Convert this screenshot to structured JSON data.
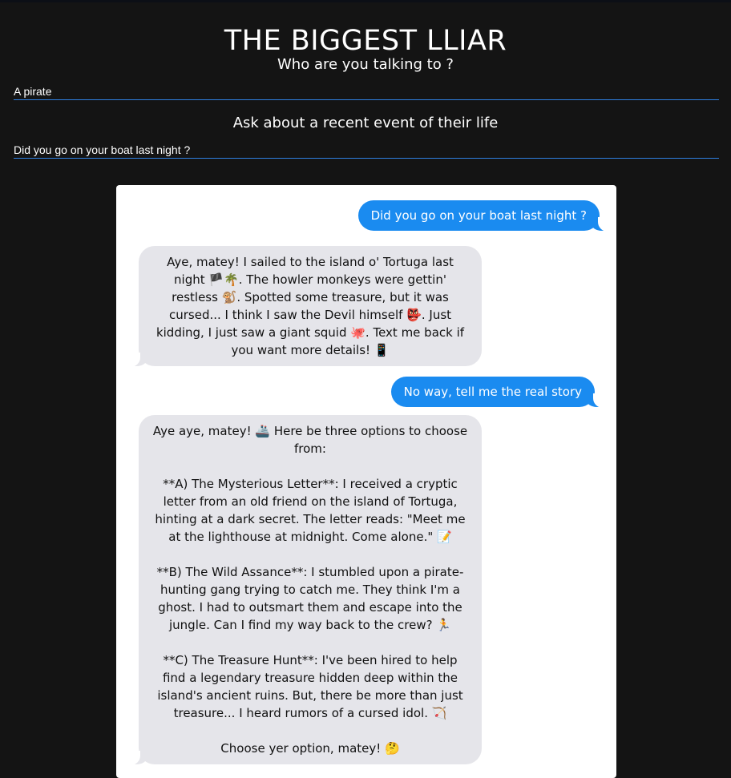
{
  "app": {
    "title": "THE BIGGEST LLIAR"
  },
  "form": {
    "who_label": "Who are you talking to ?",
    "who_value": "A pirate",
    "event_label": "Ask about a recent event of their life",
    "event_value": "Did you go on your boat last night ?"
  },
  "chat": {
    "messages": [
      {
        "role": "user",
        "text": "Did you go on your boat last night ?"
      },
      {
        "role": "assistant",
        "text": "Aye, matey! I sailed to the island o' Tortuga last night 🏴🌴. The howler monkeys were gettin' restless 🐒. Spotted some treasure, but it was cursed... I think I saw the Devil himself 👺. Just kidding, I just saw a giant squid 🐙. Text me back if you want more details! 📱"
      },
      {
        "role": "user",
        "text": "No way, tell me the real story"
      },
      {
        "role": "assistant",
        "text": "Aye aye, matey! 🚢 Here be three options to choose from:\n\n**A) The Mysterious Letter**: I received a cryptic letter from an old friend on the island of Tortuga, hinting at a dark secret. The letter reads: \"Meet me at the lighthouse at midnight. Come alone.\" 📝\n\n**B) The Wild Assance**: I stumbled upon a pirate-hunting gang trying to catch me. They think I'm a ghost. I had to outsmart them and escape into the jungle. Can I find my way back to the crew? 🏃\n\n**C) The Treasure Hunt**: I've been hired to help find a legendary treasure hidden deep within the island's ancient ruins. But, there be more than just treasure... I heard rumors of a cursed idol. 🏹\n\nChoose yer option, matey! 🤔"
      }
    ]
  },
  "colors": {
    "page_bg": "#141414",
    "accent": "#2f7fe0",
    "sent_bubble": "#1a8bf0",
    "received_bubble": "#e5e5ea"
  }
}
